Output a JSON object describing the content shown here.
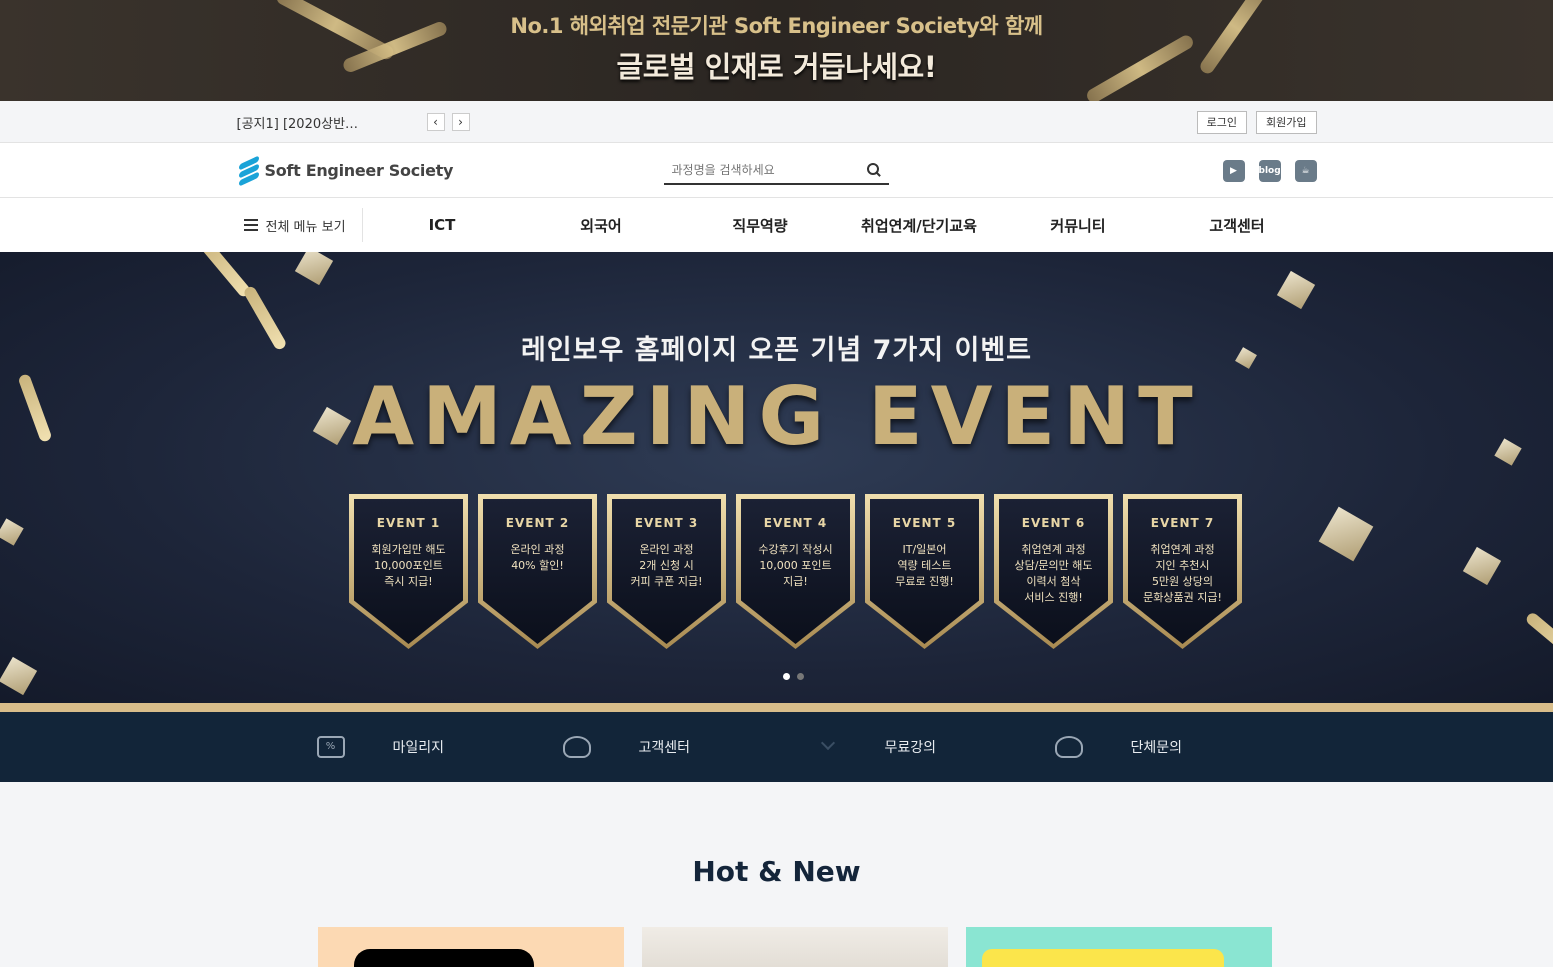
{
  "top_banner": {
    "line1": "No.1 해외취업 전문기관 Soft Engineer Society와 함께",
    "line2": "글로벌 인재로 거듭나세요!"
  },
  "notice": {
    "text": "[공지1] [2020상반…",
    "prev_icon": "chevron-left-icon",
    "next_icon": "chevron-right-icon",
    "login": "로그인",
    "signup": "회원가입"
  },
  "header": {
    "logo_text": "Soft Engineer Society",
    "search_placeholder": "과정명을 검색하세요",
    "sns": [
      {
        "icon": "youtube-icon",
        "label": "▶"
      },
      {
        "icon": "blog-icon",
        "label": "blog"
      },
      {
        "icon": "cafe-icon",
        "label": "☕"
      }
    ]
  },
  "gnb": {
    "all_menu": "전체 메뉴 보기",
    "items": [
      "ICT",
      "외국어",
      "직무역량",
      "취업연계/단기교육",
      "커뮤니티",
      "고객센터"
    ]
  },
  "hero": {
    "subtitle": "레인보우 홈페이지 오픈 기념 7가지 이벤트",
    "title": "AMAZING EVENT",
    "events": [
      {
        "title": "EVENT 1",
        "text": "회원가입만 해도\n10,000포인트\n즉시 지급!"
      },
      {
        "title": "EVENT 2",
        "text": "온라인 과정\n40% 할인!"
      },
      {
        "title": "EVENT 3",
        "text": "온라인 과정\n2개 신청 시\n커피 쿠폰 지급!"
      },
      {
        "title": "EVENT 4",
        "text": "수강후기 작성시\n10,000 포인트\n지급!"
      },
      {
        "title": "EVENT 5",
        "text": "IT/일본어\n역량 테스트\n무료로 진행!"
      },
      {
        "title": "EVENT 6",
        "text": "취업연계 과정\n상담/문의만 해도\n이력서 첨삭\n서비스 진행!"
      },
      {
        "title": "EVENT 7",
        "text": "취업연계 과정\n지인 추천시\n5만원 상당의\n문화상품권 지급!"
      }
    ],
    "active_slide": 1,
    "slide_count": 2
  },
  "quick": {
    "items": [
      {
        "icon": "coupon-icon",
        "glyph": "%",
        "label": "마일리지"
      },
      {
        "icon": "headset-icon",
        "glyph": "",
        "label": "고객센터"
      },
      {
        "icon": "chevron-down-icon",
        "glyph": "",
        "label": "무료강의"
      },
      {
        "icon": "group-icon",
        "glyph": "",
        "label": "단체문의"
      }
    ]
  },
  "section": {
    "title": "Hot & New"
  }
}
